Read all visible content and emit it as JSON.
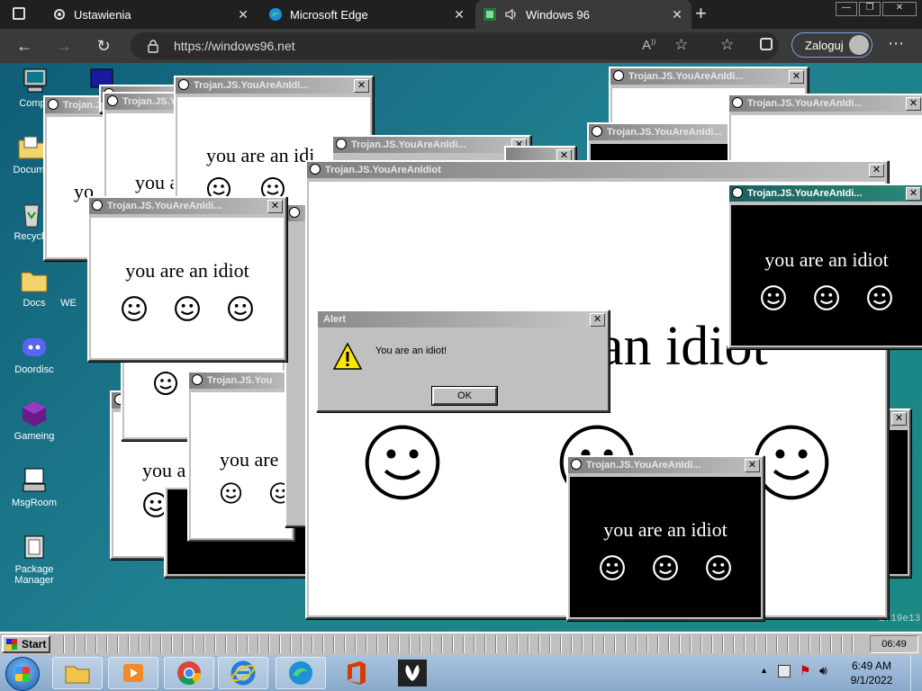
{
  "browser": {
    "tabs": [
      {
        "label": "Ustawienia",
        "icon": "gear-icon"
      },
      {
        "label": "Microsoft Edge",
        "icon": "edge-icon"
      },
      {
        "label": "Windows 96",
        "icon": "windows96-icon",
        "active": true
      }
    ],
    "url": "https://windows96.net",
    "login_label": "Zaloguj"
  },
  "desktop": {
    "icons": [
      {
        "label": "Compu",
        "icon": "computer-icon"
      },
      {
        "label": "Docume",
        "icon": "documents-folder-icon"
      },
      {
        "label": "Recycle",
        "icon": "recycle-bin-icon"
      },
      {
        "label": "Docs",
        "icon": "folder-icon"
      },
      {
        "label": "WE",
        "icon": "web-icon"
      },
      {
        "label": "Doordisc",
        "icon": "discord-icon"
      },
      {
        "label": "Gameing",
        "icon": "game-cube-icon"
      },
      {
        "label": "MsgRoom",
        "icon": "msgroom-icon"
      },
      {
        "label": "Package Manager",
        "icon": "package-icon"
      }
    ]
  },
  "popup": {
    "title": "Trojan.JS.YouAreAnIdiot",
    "title_short": "Trojan.JS.YouAreAnIdi...",
    "title_cut": "Trojan.JS.You",
    "text": "you are an idiot",
    "text_cut1": "you are an idi",
    "text_cut2": "you are",
    "text_cut3": "you a",
    "text_cut4": "yo",
    "text_cut5": "you a",
    "big_text": "an idiot",
    "corner_text": "2719e13"
  },
  "alert": {
    "title": "Alert",
    "message": "You are an idiot!",
    "ok_label": "OK"
  },
  "w96_taskbar": {
    "start_label": "Start",
    "clock": "06:49"
  },
  "win7_taskbar": {
    "time": "6:49 AM",
    "date": "9/1/2022",
    "pinned": [
      "windows-explorer-icon",
      "media-player-icon",
      "chrome-icon",
      "internet-explorer-icon",
      "edge-icon",
      "office-icon",
      "butterfly-icon"
    ]
  }
}
